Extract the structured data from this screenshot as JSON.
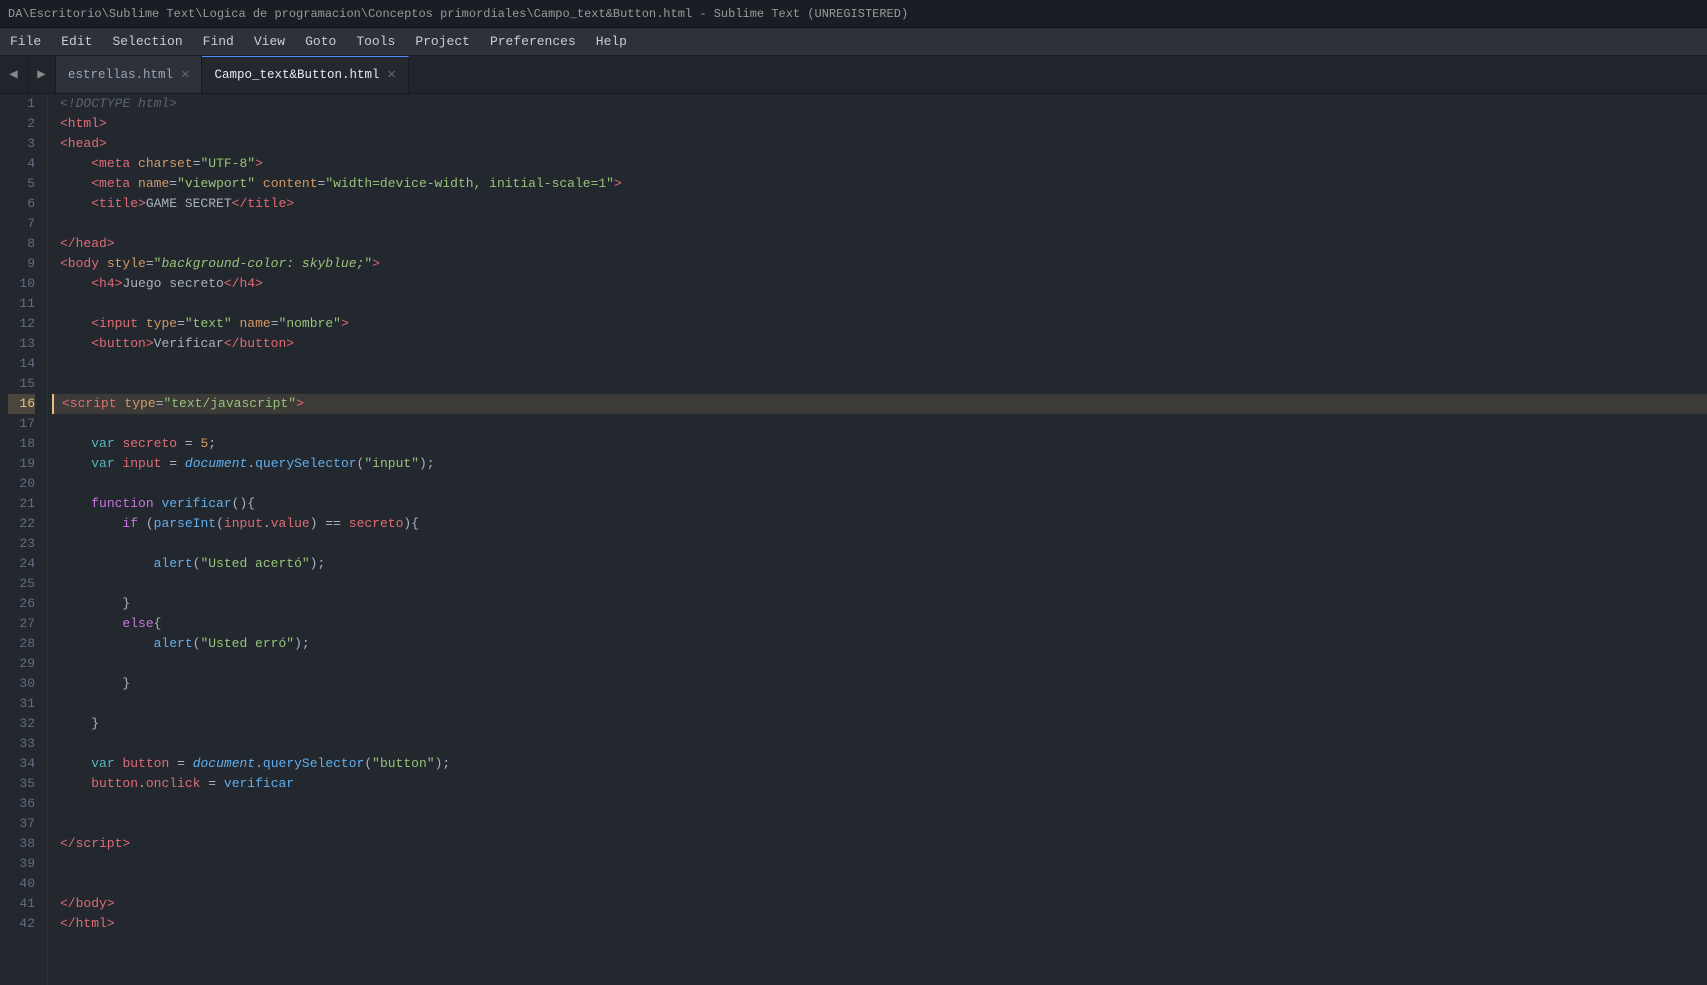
{
  "titleBar": {
    "text": "DA\\Escritorio\\Sublime Text\\Logica de programacion\\Conceptos primordiales\\Campo_text&Button.html - Sublime Text (UNREGISTERED)"
  },
  "menuBar": {
    "items": [
      "File",
      "Edit",
      "Selection",
      "Find",
      "View",
      "Goto",
      "Tools",
      "Project",
      "Preferences",
      "Help"
    ]
  },
  "tabs": [
    {
      "id": "tab1",
      "label": "estrellas.html",
      "active": false
    },
    {
      "id": "tab2",
      "label": "Campo_text&Button.html",
      "active": true
    }
  ],
  "lineNumbers": {
    "active": 16,
    "highlighted": [
      16
    ]
  }
}
